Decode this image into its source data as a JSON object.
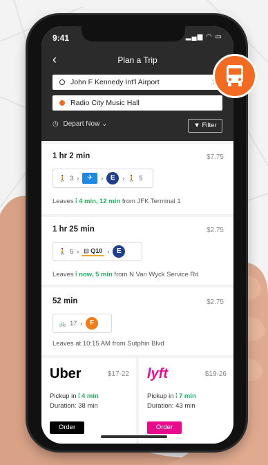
{
  "status": {
    "time": "9:41",
    "icons": "▂▄▆ ◠ ▭"
  },
  "header": {
    "back_icon": "‹",
    "title": "Plan a Trip"
  },
  "origin": {
    "value": "John F Kennedy Int'l Airport",
    "swap_icon": "⇅"
  },
  "destination": {
    "value": "Radio City Music Hall"
  },
  "controls": {
    "depart_label": "Depart Now ⌄",
    "filter_label": "Filter"
  },
  "routes": [
    {
      "duration": "1 hr 2 min",
      "price": "$7.75",
      "leaves_prefix": "Leaves ",
      "leaves_times": "4 min, 12 min",
      "leaves_suffix": " from JFK Terminal 1",
      "walk1": "3",
      "walk2": "5",
      "line": "E"
    },
    {
      "duration": "1 hr 25 min",
      "price": "$2.75",
      "leaves_prefix": "Leaves ",
      "leaves_times": "now, 5 min",
      "leaves_suffix": " from N Van Wyck Service Rd",
      "walk1": "5",
      "bus": "Q10",
      "line": "E"
    },
    {
      "duration": "52 min",
      "price": "$2.75",
      "leaves_text": "Leaves at 10:15 AM from Sutphin Blvd",
      "bike": "17",
      "line": "F"
    }
  ],
  "rides": [
    {
      "brand": "Uber",
      "price": "$17-22",
      "pickup_prefix": "Pickup in ",
      "pickup_time": "4 min",
      "duration": "Duration: 38 min",
      "order_label": "Order",
      "color": "#000000"
    },
    {
      "brand": "lyft",
      "price": "$19-26",
      "pickup_prefix": "Pickup in ",
      "pickup_time": "7 min",
      "duration": "Duration: 43 min",
      "order_label": "Order",
      "color": "#ea0b8c"
    }
  ],
  "colors": {
    "accent_orange": "#f36b21",
    "dark_header": "#2b2b2b",
    "subway_e": "#1f3f8f",
    "subway_f": "#f07d1a",
    "green": "#27ae60"
  },
  "icons": [
    "walk-icon",
    "plane-icon",
    "bus-icon",
    "bike-icon",
    "clock-icon",
    "filter-icon",
    "signal-icon"
  ]
}
